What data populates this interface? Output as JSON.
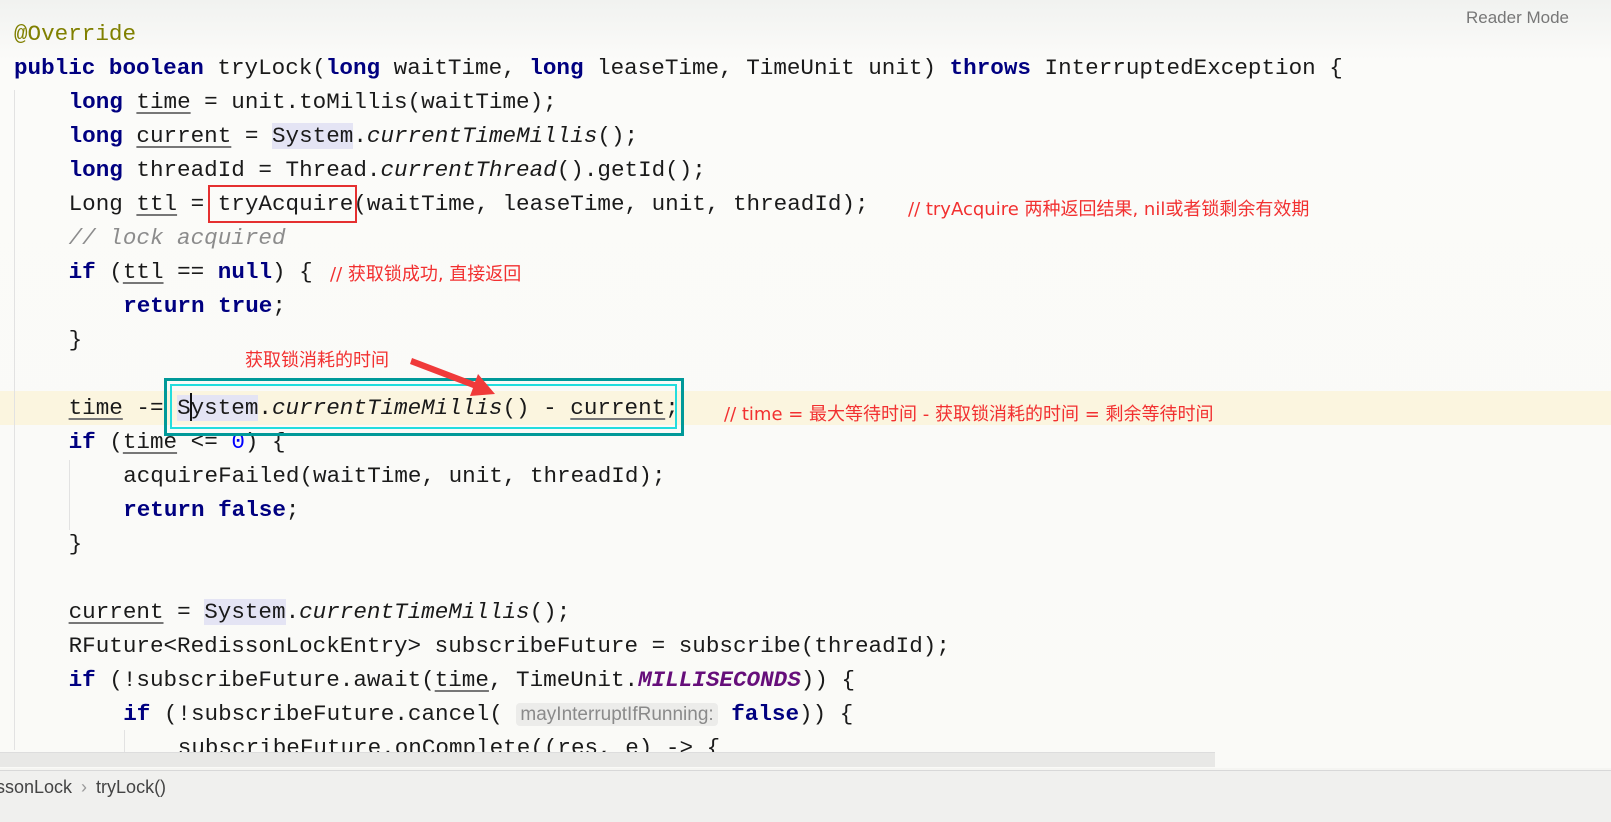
{
  "reader_mode": "Reader Mode",
  "breadcrumb": {
    "items": [
      "ssonLock",
      "tryLock()"
    ],
    "separator": "›"
  },
  "colors": {
    "annotation_red": "#f23030",
    "box_teal_outer": "#009999",
    "box_teal_inner": "#22dddd",
    "keyword": "#000080",
    "field": "#660e7a"
  },
  "code": [
    {
      "line": 1,
      "indent": 0,
      "tokens": [
        [
          "a",
          "@Override"
        ]
      ]
    },
    {
      "line": 2,
      "indent": 0,
      "tokens": [
        [
          "k",
          "public"
        ],
        [
          "p",
          " "
        ],
        [
          "k",
          "boolean"
        ],
        [
          "p",
          " tryLock("
        ],
        [
          "k",
          "long"
        ],
        [
          "p",
          " waitTime, "
        ],
        [
          "k",
          "long"
        ],
        [
          "p",
          " leaseTime, TimeUnit unit) "
        ],
        [
          "k",
          "throws"
        ],
        [
          "p",
          " InterruptedException {"
        ]
      ]
    },
    {
      "line": 3,
      "indent": 1,
      "tokens": [
        [
          "k",
          "long"
        ],
        [
          "p",
          " "
        ],
        [
          "u",
          "time"
        ],
        [
          "p",
          " = unit.toMillis(waitTime);"
        ]
      ]
    },
    {
      "line": 4,
      "indent": 1,
      "tokens": [
        [
          "k",
          "long"
        ],
        [
          "p",
          " "
        ],
        [
          "u",
          "current"
        ],
        [
          "p",
          " = "
        ],
        [
          "s",
          "System"
        ],
        [
          "p",
          "."
        ],
        [
          "i",
          "currentTimeMillis"
        ],
        [
          "p",
          "();"
        ]
      ]
    },
    {
      "line": 5,
      "indent": 1,
      "tokens": [
        [
          "k",
          "long"
        ],
        [
          "p",
          " threadId = Thread."
        ],
        [
          "i",
          "currentThread"
        ],
        [
          "p",
          "().getId();"
        ]
      ]
    },
    {
      "line": 6,
      "indent": 1,
      "tokens": [
        [
          "p",
          "Long "
        ],
        [
          "u",
          "ttl"
        ],
        [
          "p",
          " = tryAcquire(waitTime, leaseTime, unit, threadId);"
        ]
      ]
    },
    {
      "line": 7,
      "indent": 1,
      "tokens": [
        [
          "c",
          "// lock acquired"
        ]
      ]
    },
    {
      "line": 8,
      "indent": 1,
      "tokens": [
        [
          "k",
          "if"
        ],
        [
          "p",
          " ("
        ],
        [
          "u",
          "ttl"
        ],
        [
          "p",
          " == "
        ],
        [
          "k",
          "null"
        ],
        [
          "p",
          ") {"
        ]
      ]
    },
    {
      "line": 9,
      "indent": 2,
      "tokens": [
        [
          "k",
          "return"
        ],
        [
          "p",
          " "
        ],
        [
          "k",
          "true"
        ],
        [
          "p",
          ";"
        ]
      ]
    },
    {
      "line": 10,
      "indent": 1,
      "tokens": [
        [
          "p",
          "}"
        ]
      ]
    },
    {
      "line": 12,
      "indent": 1,
      "tokens": [
        [
          "u",
          "time"
        ],
        [
          "p",
          " -= "
        ],
        [
          "s",
          "System"
        ],
        [
          "p",
          "."
        ],
        [
          "i",
          "currentTimeMillis"
        ],
        [
          "p",
          "() - "
        ],
        [
          "u",
          "current"
        ],
        [
          "p",
          ";"
        ]
      ]
    },
    {
      "line": 13,
      "indent": 1,
      "tokens": [
        [
          "k",
          "if"
        ],
        [
          "p",
          " ("
        ],
        [
          "u",
          "time"
        ],
        [
          "p",
          " <= "
        ],
        [
          "n",
          "0"
        ],
        [
          "p",
          ") {"
        ]
      ]
    },
    {
      "line": 14,
      "indent": 2,
      "tokens": [
        [
          "p",
          "acquireFailed(waitTime, unit, threadId);"
        ]
      ]
    },
    {
      "line": 15,
      "indent": 2,
      "tokens": [
        [
          "k",
          "return"
        ],
        [
          "p",
          " "
        ],
        [
          "k",
          "false"
        ],
        [
          "p",
          ";"
        ]
      ]
    },
    {
      "line": 16,
      "indent": 1,
      "tokens": [
        [
          "p",
          "}"
        ]
      ]
    },
    {
      "line": 18,
      "indent": 1,
      "tokens": [
        [
          "u",
          "current"
        ],
        [
          "p",
          " = "
        ],
        [
          "s",
          "System"
        ],
        [
          "p",
          "."
        ],
        [
          "i",
          "currentTimeMillis"
        ],
        [
          "p",
          "();"
        ]
      ]
    },
    {
      "line": 19,
      "indent": 1,
      "tokens": [
        [
          "p",
          "RFuture<RedissonLockEntry> subscribeFuture = subscribe(threadId);"
        ]
      ]
    },
    {
      "line": 20,
      "indent": 1,
      "tokens": [
        [
          "k",
          "if"
        ],
        [
          "p",
          " (!subscribeFuture.await("
        ],
        [
          "u",
          "time"
        ],
        [
          "p",
          ", TimeUnit."
        ],
        [
          "f",
          "MILLISECONDS"
        ],
        [
          "p",
          ")) {"
        ]
      ]
    },
    {
      "line": 21,
      "indent": 2,
      "tokens": [
        [
          "k",
          "if"
        ],
        [
          "p",
          " (!subscribeFuture.cancel( "
        ],
        [
          "h",
          "mayInterruptIfRunning:"
        ],
        [
          "p",
          " "
        ],
        [
          "k",
          "false"
        ],
        [
          "p",
          ")) {"
        ]
      ]
    },
    {
      "line": 22,
      "indent": 3,
      "tokens": [
        [
          "p",
          "subscribeFuture.onComplete((res, e) -> {"
        ]
      ]
    }
  ],
  "annotations": {
    "try_acquire_note": "// tryAcquire 两种返回结果, nil或者锁剩余有效期",
    "success_note": "// 获取锁成功, 直接返回",
    "elapsed_label": "获取锁消耗的时间",
    "time_note": "// time = 最大等待时间 - 获取锁消耗的时间 = 剩余等待时间"
  }
}
